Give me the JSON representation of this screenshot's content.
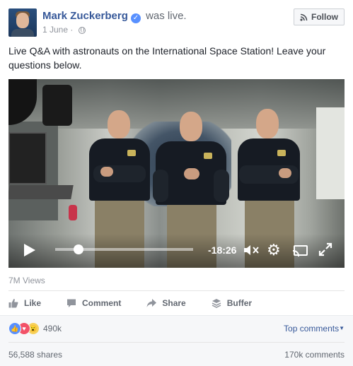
{
  "header": {
    "author": "Mark Zuckerberg",
    "status": "was live.",
    "date": "1 June",
    "follow_label": "Follow"
  },
  "post": {
    "text": "Live Q&A with astronauts on the International Space Station! Leave your questions below."
  },
  "video": {
    "time_remaining": "-18:26",
    "progress": 0.17
  },
  "views": "7M Views",
  "actions": {
    "like": "Like",
    "comment": "Comment",
    "share": "Share",
    "buffer": "Buffer"
  },
  "footer": {
    "reaction_count": "490k",
    "top_comments": "Top comments",
    "shares": "56,588 shares",
    "comments": "170k comments"
  },
  "colors": {
    "link_blue": "#365899",
    "verified_blue": "#5890ff",
    "meta_gray": "#90949c"
  }
}
